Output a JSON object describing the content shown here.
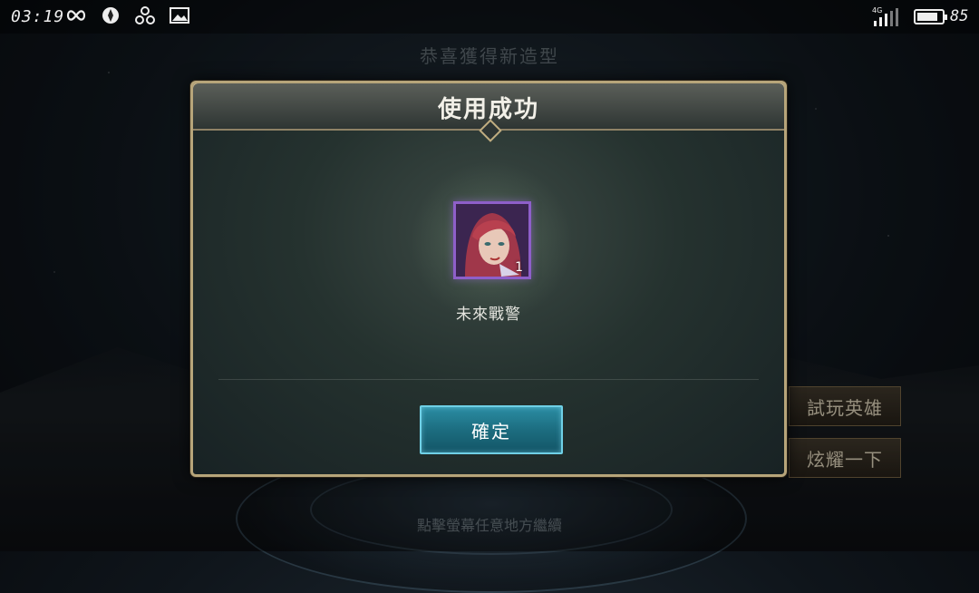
{
  "status_bar": {
    "time": "03:19",
    "network_label": "4G",
    "battery_percent": 85,
    "battery_text": "85",
    "icons": [
      "infinity-icon",
      "app-icon",
      "share-icon",
      "image-icon"
    ]
  },
  "background": {
    "title": "恭喜獲得新造型",
    "buttons": [
      {
        "label": "試玩英雄"
      },
      {
        "label": "炫耀一下"
      }
    ],
    "tap_hint": "點擊螢幕任意地方繼續"
  },
  "dialog": {
    "title": "使用成功",
    "item": {
      "name": "未來戰警",
      "count": "1"
    },
    "confirm_label": "確定"
  },
  "colors": {
    "frame_gold": "#b7a57a",
    "button_teal": "#2b8da3",
    "card_purple": "#8e5fc9"
  }
}
